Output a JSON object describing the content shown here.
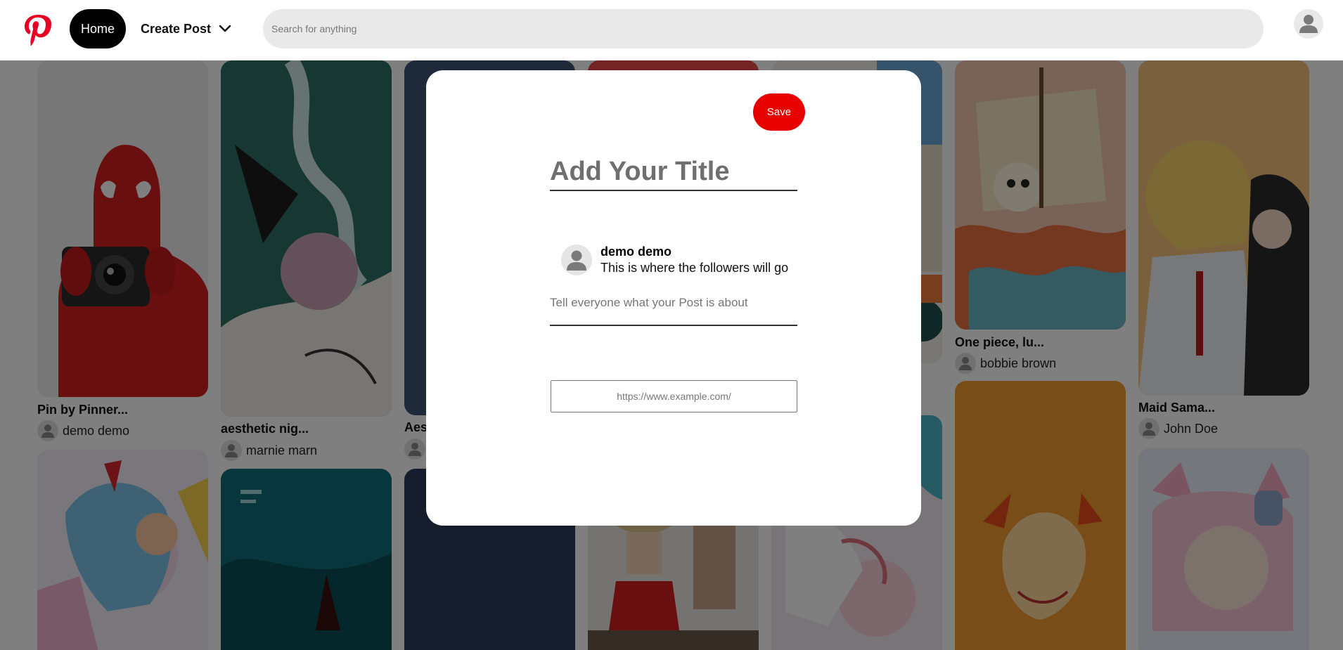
{
  "header": {
    "logo_icon": "pinterest-logo-icon",
    "brand_color": "#e60023",
    "home_label": "Home",
    "create_label": "Create Post",
    "create_icon": "chevron-down-icon",
    "search_placeholder": "Search for anything",
    "avatar_icon": "user-icon"
  },
  "pins": [
    {
      "title": "Pin by Pinner...",
      "author": "demo demo",
      "art": "spiderman-camera"
    },
    {
      "title": "aesthetic nig...",
      "author": "marnie marn",
      "art": "teal-anime"
    },
    {
      "title": "Aes",
      "author": "",
      "art": "dark-navy"
    },
    {
      "title": "",
      "author": "",
      "art": "red-poster"
    },
    {
      "title": "",
      "author": "",
      "art": "sticker-collage"
    },
    {
      "title": "One piece, lu...",
      "author": "bobbie brown",
      "art": "one-piece-ship"
    },
    {
      "title": "Maid Sama...",
      "author": "John Doe",
      "art": "maid-sama"
    },
    {
      "title": "",
      "author": "",
      "art": "colorful-anime"
    },
    {
      "title": "",
      "author": "",
      "art": "teal-wave"
    },
    {
      "title": "",
      "author": "",
      "art": "dark-sky"
    },
    {
      "title": "",
      "author": "",
      "art": "luffy-fight"
    },
    {
      "title": "",
      "author": "",
      "art": "pink-teal-anime"
    },
    {
      "title": "",
      "author": "",
      "art": "orange-fire"
    },
    {
      "title": "",
      "author": "",
      "art": "pink-cat-anime"
    }
  ],
  "modal": {
    "save_label": "Save",
    "save_color": "#e60000",
    "title_placeholder": "Add Your Title",
    "user": {
      "name": "demo demo",
      "followers_text": "This is where the followers will go",
      "avatar_icon": "user-icon"
    },
    "description_placeholder": "Tell everyone what your Post is about",
    "url_placeholder": "https://www.example.com/"
  }
}
